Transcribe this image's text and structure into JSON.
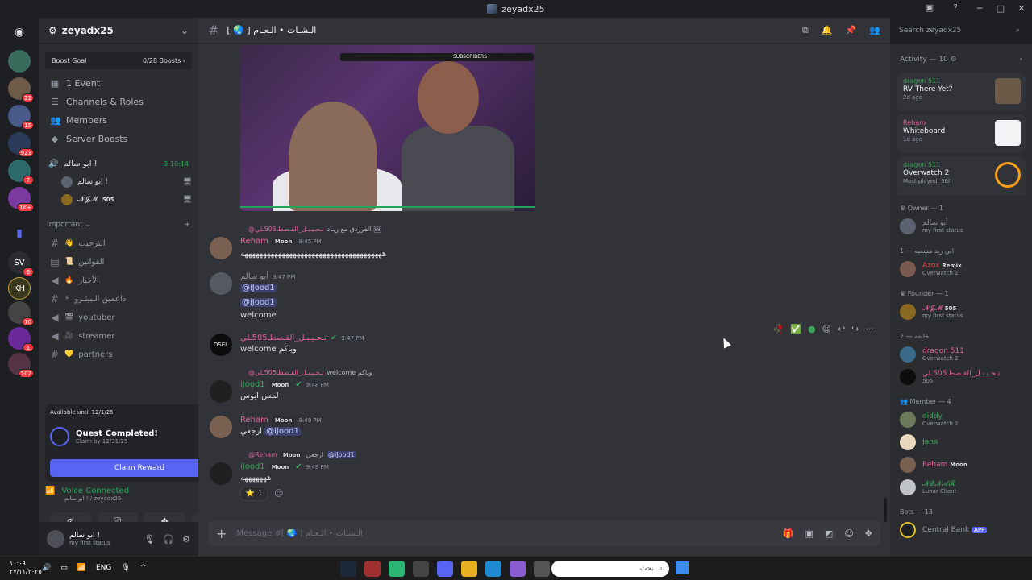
{
  "titlebar": {
    "title": "zeyadx25"
  },
  "rail": {
    "badges": [
      "22",
      "15",
      "923",
      "7",
      "1K+",
      "6",
      "70",
      "1",
      "102"
    ]
  },
  "guild": {
    "name": "zeyadx25",
    "boost_goal": "Boost Goal",
    "boost_count": "0/28 Boosts",
    "nav": [
      "1 Event",
      "Channels & Roles",
      "Members",
      "Server Boosts"
    ]
  },
  "voice_channel": {
    "name": "ابو سالم !",
    "timer": "3:10:14",
    "users": [
      {
        "name": "ابو سالم !"
      },
      {
        "name": "𝓝𝓙𝓜",
        "tag": "505"
      }
    ]
  },
  "category": {
    "name": "Important"
  },
  "channels": [
    {
      "emoji": "👋",
      "name": "الترحيب"
    },
    {
      "emoji": "📜",
      "name": "القوانين"
    },
    {
      "emoji": "🔥",
      "name": "الأخبار"
    },
    {
      "emoji": "⚡",
      "name": "داعمين الـبيثـرو"
    },
    {
      "emoji": "🎬",
      "name": "youtuber"
    },
    {
      "emoji": "🎥",
      "name": "streamer"
    },
    {
      "emoji": "💛",
      "name": "partners"
    }
  ],
  "quest": {
    "available": "Available until 12/1/25",
    "title": "Quest Completed!",
    "subtitle": "Claim by 12/31/25",
    "claim_label": "Claim Reward"
  },
  "voice_connected": {
    "status": "Voice Connected",
    "detail": "ابو سالم ! / zeyadx25"
  },
  "user": {
    "name": "ابو سالم !",
    "status": "my first status"
  },
  "chat": {
    "channel_name": "[ 🌏 ] الـشـات • الـعـام",
    "stream_overlay": "SUBSCRIBERS",
    "messages": [
      {
        "reply_author": "@تـحـيـبـل_القـصطـ505ـلي",
        "reply_text": "الفرزدق مع زيـاد 🖼",
        "author": "Reham",
        "tag": "Moon",
        "time": "9:45 PM",
        "text": "ههههههههههههههههههههههههههههههههههههههه"
      },
      {
        "author": "أبو سالم",
        "time": "9:47 PM",
        "lines": [
          "@iJood1",
          "@iJood1",
          "welcome"
        ]
      },
      {
        "author": "تـحـيـبـل_القـصطـ505ـلي",
        "time": "9:47 PM",
        "text": "welcome وياكم"
      },
      {
        "reply_author": "@تـحـيـبـل_القـصطـ505ـلي",
        "reply_text": "welcome وياكم",
        "author": "iJood1",
        "tag": "Moon",
        "time": "9:48 PM",
        "text": "لمس ايوس"
      },
      {
        "author": "Reham",
        "tag": "Moon",
        "time": "9:49 PM",
        "text": "ارجعي",
        "mention": "@iJood1"
      },
      {
        "reply_author": "@Reham",
        "reply_tag": "Moon",
        "reply_text": "ارجعي",
        "reply_mention": "@iJood1",
        "author": "iJood1",
        "tag": "Moon",
        "time": "9:49 PM",
        "text": "هههههههه"
      }
    ],
    "reaction": {
      "emoji": "⭐",
      "count": "1"
    },
    "composer_placeholder": "Message #[ 🌏 ] الـشـات • الـعـام"
  },
  "search": {
    "placeholder": "Search zeyadx25"
  },
  "members": {
    "activity_header": "Activity — 10",
    "activities": [
      {
        "user": "dragon 511",
        "title": "RV There Yet?",
        "meta": "2d ago"
      },
      {
        "user": "Reham",
        "title": "Whiteboard",
        "meta": "1d ago"
      },
      {
        "user": "dragon 511",
        "title": "Overwatch 2",
        "meta": "Most played: 36h"
      }
    ],
    "groups": [
      {
        "label": "Owner — 1",
        "members": [
          {
            "name": "أبو سالم",
            "status": "my first status"
          }
        ]
      },
      {
        "label": "الي زيد مشفيه — 1",
        "members": [
          {
            "name": "Azox",
            "tag": "Remix",
            "status": "Overwatch 2"
          }
        ]
      },
      {
        "label": "Founder — 1",
        "members": [
          {
            "name": "𝓝𝓙𝓜",
            "tag": "505",
            "status": "my first status"
          }
        ]
      },
      {
        "label": "خايفه — 2",
        "members": [
          {
            "name": "dragon 511",
            "status": "Overwatch 2"
          },
          {
            "name": "تـحـيـبـل_القـصطـ505ـلي",
            "status": "505"
          }
        ]
      },
      {
        "label": "Member — 4",
        "members": [
          {
            "name": "diddy",
            "status": "Overwatch 2"
          },
          {
            "name": "Jana",
            "status": ""
          },
          {
            "name": "Reham",
            "tag": "Moon",
            "status": ""
          },
          {
            "name": "𝓝𝓠𝓝𝓐𝓡",
            "status": "Lunar Client"
          }
        ]
      },
      {
        "label": "Bots — 13",
        "members": [
          {
            "name": "Central Bank",
            "tag": "APP",
            "status": ""
          }
        ]
      }
    ]
  },
  "taskbar": {
    "time": "١٠:٠٩",
    "date": "٢٧/١١/٢٠٢٥",
    "lang": "ENG",
    "search_placeholder": "بحث"
  }
}
